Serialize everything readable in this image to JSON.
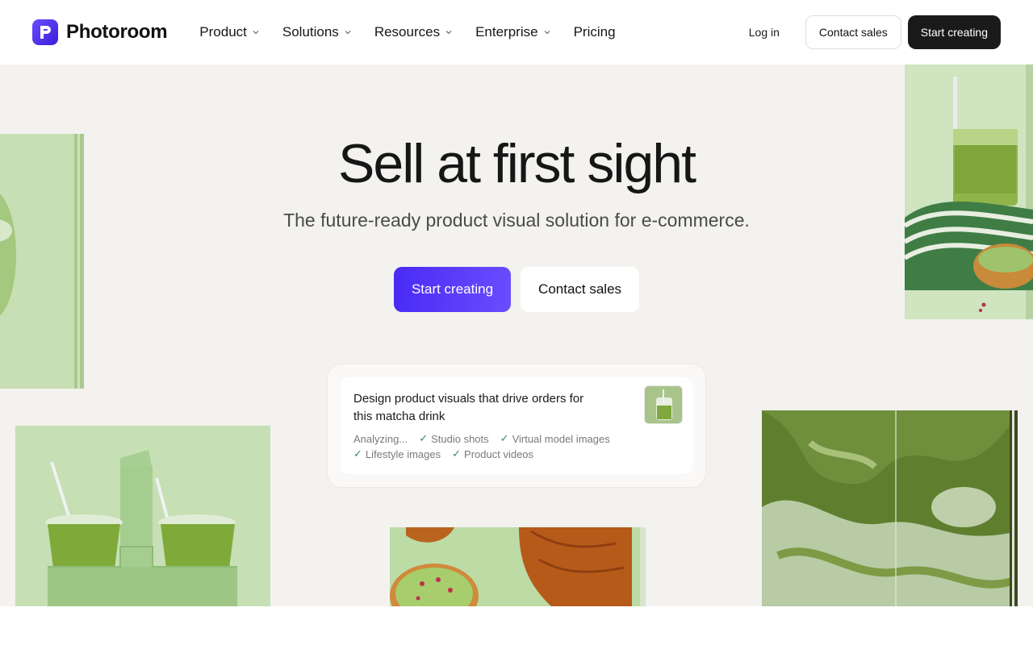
{
  "brand": {
    "name": "Photoroom",
    "logo_icon": "photoroom-logo-icon"
  },
  "nav": {
    "items": [
      {
        "label": "Product",
        "has_dropdown": true
      },
      {
        "label": "Solutions",
        "has_dropdown": true
      },
      {
        "label": "Resources",
        "has_dropdown": true
      },
      {
        "label": "Enterprise",
        "has_dropdown": true
      },
      {
        "label": "Pricing",
        "has_dropdown": false
      }
    ]
  },
  "header_actions": {
    "login": "Log in",
    "contact_sales": "Contact sales",
    "start_creating": "Start creating"
  },
  "hero": {
    "title": "Sell at first sight",
    "subtitle": "The future-ready product visual solution for e-commerce.",
    "cta_primary": "Start creating",
    "cta_secondary": "Contact sales"
  },
  "prompt_card": {
    "text": "Design product visuals that drive orders for this matcha drink",
    "status": "Analyzing...",
    "tags": [
      "Studio shots",
      "Virtual model images",
      "Lifestyle images",
      "Product videos"
    ],
    "thumb_icon": "matcha-drink-thumbnail"
  },
  "colors": {
    "accent": "#4a2bf5",
    "dark_button": "#1a1a1a",
    "hero_bg": "#f3f2ef",
    "check": "#2e8b57"
  }
}
